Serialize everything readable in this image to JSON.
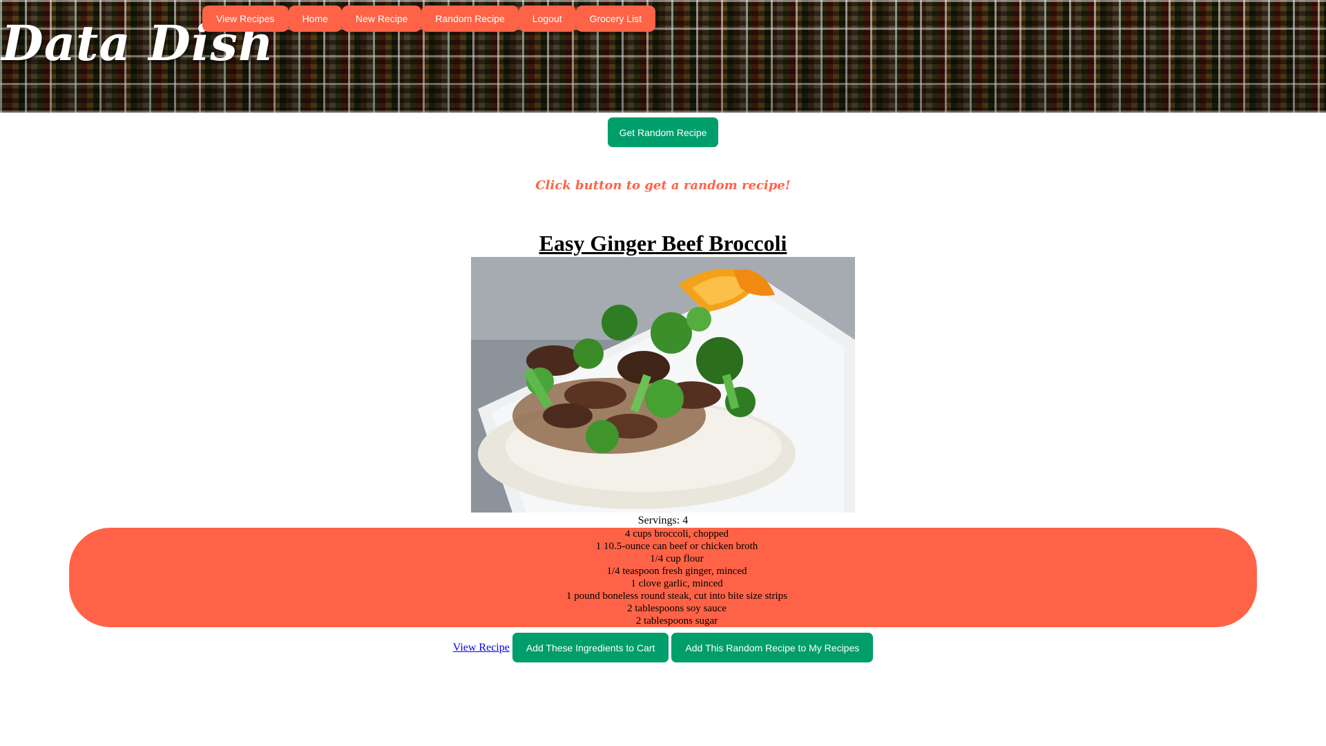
{
  "brand": {
    "title": "Data Dish"
  },
  "nav": {
    "items": [
      {
        "label": "View Recipes"
      },
      {
        "label": "Home"
      },
      {
        "label": "New Recipe"
      },
      {
        "label": "Random Recipe"
      },
      {
        "label": "Logout"
      },
      {
        "label": "Grocery List"
      }
    ]
  },
  "main": {
    "get_random_label": "Get Random Recipe",
    "prompt": "Click button to get a random recipe!"
  },
  "recipe": {
    "title": "Easy Ginger Beef Broccoli",
    "image_alt": "ginger beef broccoli over rice on a white plate",
    "servings": "Servings: 4",
    "ingredients": [
      "4 cups broccoli, chopped",
      "1 10.5-ounce can beef or chicken broth",
      "1/4 cup flour",
      "1/4 teaspoon fresh ginger, minced",
      "1 clove garlic, minced",
      "1 pound boneless round steak, cut into bite size strips",
      "2 tablespoons soy sauce",
      "2 tablespoons sugar"
    ]
  },
  "actions": {
    "view_recipe": "View Recipe",
    "add_to_cart": "Add These Ingredients to Cart",
    "add_to_my_recipes": "Add This Random Recipe to My Recipes"
  },
  "colors": {
    "accent_red": "#ff6347",
    "accent_green": "#009e6b",
    "link_blue": "#0000ee"
  }
}
